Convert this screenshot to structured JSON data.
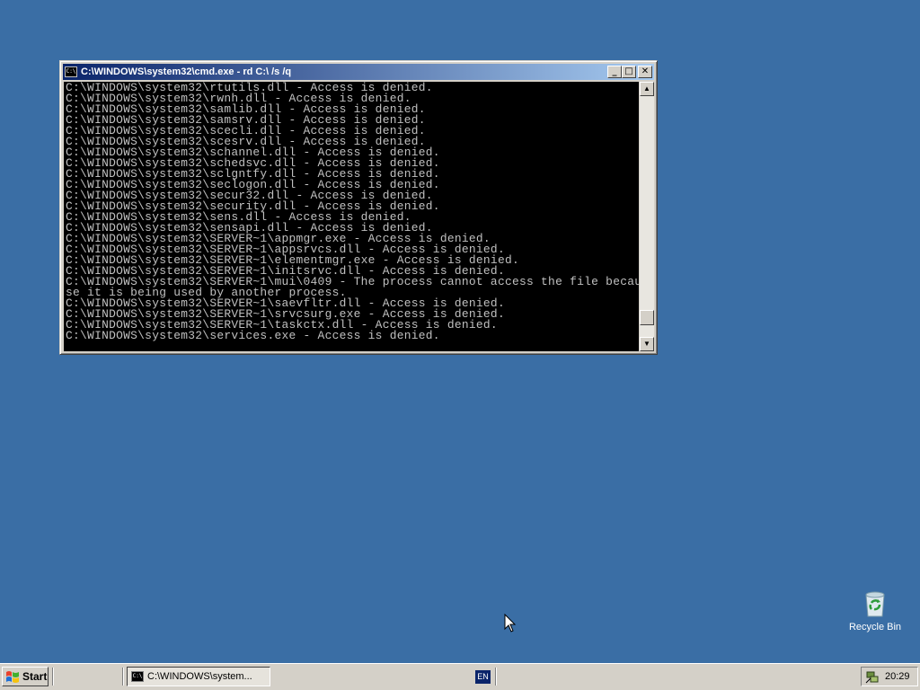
{
  "window": {
    "title": "C:\\WINDOWS\\system32\\cmd.exe - rd C:\\ /s /q",
    "icon_label": "C:\\",
    "controls": {
      "minimize": "_",
      "maximize": "□",
      "close": "✕"
    },
    "console_lines": [
      "C:\\WINDOWS\\system32\\rtutils.dll - Access is denied.",
      "C:\\WINDOWS\\system32\\rwnh.dll - Access is denied.",
      "C:\\WINDOWS\\system32\\samlib.dll - Access is denied.",
      "C:\\WINDOWS\\system32\\samsrv.dll - Access is denied.",
      "C:\\WINDOWS\\system32\\scecli.dll - Access is denied.",
      "C:\\WINDOWS\\system32\\scesrv.dll - Access is denied.",
      "C:\\WINDOWS\\system32\\schannel.dll - Access is denied.",
      "C:\\WINDOWS\\system32\\schedsvc.dll - Access is denied.",
      "C:\\WINDOWS\\system32\\sclgntfy.dll - Access is denied.",
      "C:\\WINDOWS\\system32\\seclogon.dll - Access is denied.",
      "C:\\WINDOWS\\system32\\secur32.dll - Access is denied.",
      "C:\\WINDOWS\\system32\\security.dll - Access is denied.",
      "C:\\WINDOWS\\system32\\sens.dll - Access is denied.",
      "C:\\WINDOWS\\system32\\sensapi.dll - Access is denied.",
      "C:\\WINDOWS\\system32\\SERVER~1\\appmgr.exe - Access is denied.",
      "C:\\WINDOWS\\system32\\SERVER~1\\appsrvcs.dll - Access is denied.",
      "C:\\WINDOWS\\system32\\SERVER~1\\elementmgr.exe - Access is denied.",
      "C:\\WINDOWS\\system32\\SERVER~1\\initsrvc.dll - Access is denied.",
      "C:\\WINDOWS\\system32\\SERVER~1\\mui\\0409 - The process cannot access the file becau",
      "se it is being used by another process.",
      "C:\\WINDOWS\\system32\\SERVER~1\\saevfltr.dll - Access is denied.",
      "C:\\WINDOWS\\system32\\SERVER~1\\srvcsurg.exe - Access is denied.",
      "C:\\WINDOWS\\system32\\SERVER~1\\taskctx.dll - Access is denied.",
      "C:\\WINDOWS\\system32\\services.exe - Access is denied."
    ],
    "scroll_position": 0.95
  },
  "desktop": {
    "recycle_bin_label": "Recycle Bin"
  },
  "taskbar": {
    "start_label": "Start",
    "task_label": "C:\\WINDOWS\\system...",
    "task_icon_label": "C:\\",
    "language": "EN",
    "clock": "20:29"
  },
  "colors": {
    "desktop": "#3a6ea5",
    "title_active_start": "#0a246a",
    "title_active_end": "#a6caf0",
    "console_bg": "#000000",
    "console_fg": "#c0c0c0"
  }
}
